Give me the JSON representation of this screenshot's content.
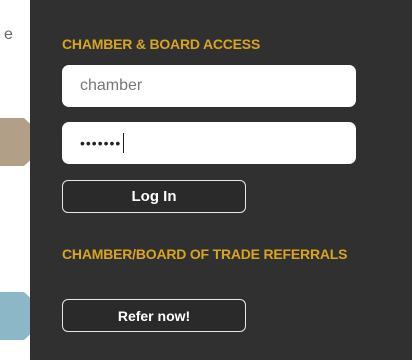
{
  "colors": {
    "panel_bg": "#303030",
    "heading_gold": "#d9a521",
    "arrow_tan": "#b29f88",
    "arrow_blue": "#8cb7c7"
  },
  "left": {
    "letter": "e"
  },
  "access": {
    "heading": "CHAMBER & BOARD ACCESS",
    "username_value": "chamber",
    "password_masked": "•••••••",
    "login_label": "Log In"
  },
  "referrals": {
    "heading": "CHAMBER/BOARD OF TRADE REFERRALS",
    "refer_label": "Refer now!"
  }
}
